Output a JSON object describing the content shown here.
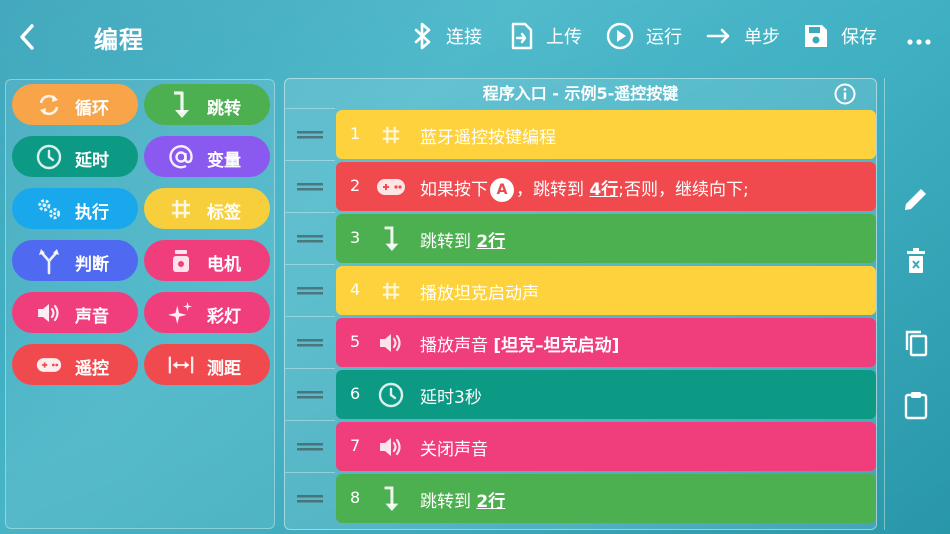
{
  "header": {
    "title": "编程",
    "tools": {
      "bluetooth_label": "连接",
      "upload_label": "上传",
      "run_label": "运行",
      "step_label": "单步",
      "save_label": "保存"
    }
  },
  "palette": {
    "items": [
      {
        "label": "循环",
        "color": "#f8a54a",
        "icon": "loop-icon"
      },
      {
        "label": "跳转",
        "color": "#4caf50",
        "icon": "jump-down-arrow-icon"
      },
      {
        "label": "延时",
        "color": "#0c9a85",
        "icon": "clock-icon"
      },
      {
        "label": "变量",
        "color": "#8a59f0",
        "icon": "at-sign-icon"
      },
      {
        "label": "执行",
        "color": "#1aa8ec",
        "icon": "gears-icon"
      },
      {
        "label": "标签",
        "color": "#f7cf3c",
        "icon": "hash-icon"
      },
      {
        "label": "判断",
        "color": "#4f6af0",
        "icon": "fork-icon"
      },
      {
        "label": "电机",
        "color": "#f03e7d",
        "icon": "motor-icon"
      },
      {
        "label": "声音",
        "color": "#f03e7d",
        "icon": "speaker-icon"
      },
      {
        "label": "彩灯",
        "color": "#f03e7d",
        "icon": "sparkle-icon"
      },
      {
        "label": "遥控",
        "color": "#f04a4f",
        "icon": "gamepad-icon"
      },
      {
        "label": "测距",
        "color": "#f04a4f",
        "icon": "distance-icon"
      }
    ]
  },
  "program": {
    "title": "程序入口 - 示例5-遥控按键",
    "rows": [
      {
        "num": "1",
        "color": "#fdd23c",
        "icon": "hash-icon",
        "text": "蓝牙遥控按键编程"
      },
      {
        "num": "2",
        "color": "#f04a4f",
        "icon": "gamepad-icon",
        "pre": "如果按下",
        "badge": "A",
        "mid": "，跳转到 ",
        "link": "4行",
        "post": ";否则，继续向下;"
      },
      {
        "num": "3",
        "color": "#4caf50",
        "icon": "jump-down-arrow-icon",
        "pre": "跳转到 ",
        "link": "2行"
      },
      {
        "num": "4",
        "color": "#fdd23c",
        "icon": "hash-icon",
        "text": "播放坦克启动声"
      },
      {
        "num": "5",
        "color": "#f03e7d",
        "icon": "speaker-icon",
        "pre": "播放声音 ",
        "bold": "[坦克–坦克启动]"
      },
      {
        "num": "6",
        "color": "#0c9a85",
        "icon": "clock-icon",
        "text": "延时3秒"
      },
      {
        "num": "7",
        "color": "#f03e7d",
        "icon": "speaker-icon",
        "text": "关闭声音"
      },
      {
        "num": "8",
        "color": "#4caf50",
        "icon": "jump-down-arrow-icon",
        "pre": "跳转到 ",
        "link": "2行"
      }
    ]
  }
}
